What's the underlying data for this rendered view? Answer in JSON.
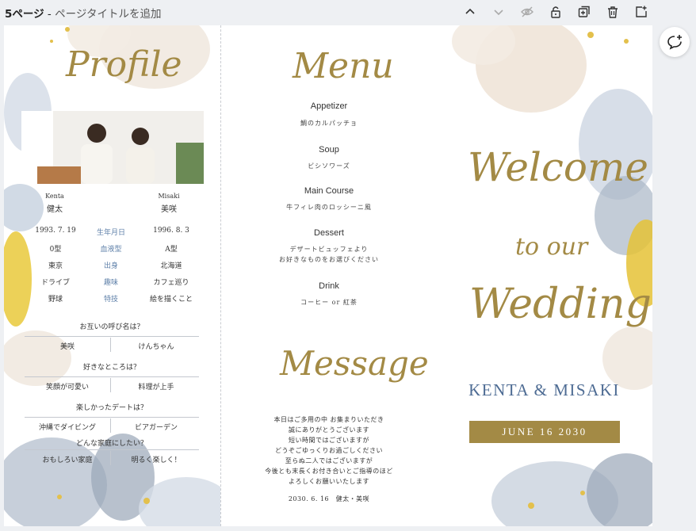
{
  "topbar": {
    "page_label": "5ページ",
    "separator": " - ",
    "title_placeholder": "ページタイトルを追加",
    "icons": [
      "chevron-up-icon",
      "chevron-down-icon",
      "eye-hidden-icon",
      "lock-icon",
      "duplicate-icon",
      "trash-icon",
      "add-page-icon"
    ]
  },
  "profile": {
    "heading": "Profile",
    "groom_en": "Kenta",
    "groom_jp": "健太",
    "bride_en": "Misaki",
    "bride_jp": "美咲",
    "rows": [
      {
        "groom": "1993. 7. 19",
        "label": "生年月日",
        "bride": "1996. 8. 3"
      },
      {
        "groom": "0型",
        "label": "血液型",
        "bride": "A型"
      },
      {
        "groom": "東京",
        "label": "出身",
        "bride": "北海道"
      },
      {
        "groom": "ドライブ",
        "label": "趣味",
        "bride": "カフェ巡り"
      },
      {
        "groom": "野球",
        "label": "特技",
        "bride": "絵を描くこと"
      }
    ],
    "qa": [
      {
        "q": "お互いの呼び名は？",
        "a1": "美咲",
        "a2": "けんちゃん"
      },
      {
        "q": "好きなところは？",
        "a1": "笑顔が可愛い",
        "a2": "料理が上手"
      },
      {
        "q": "楽しかったデートは？",
        "a1": "沖縄でダイビング",
        "a2": "ビアガーデン"
      },
      {
        "q": "どんな家庭にしたい？",
        "a1": "おもしろい家庭",
        "a2": "明るく楽しく！"
      }
    ]
  },
  "menu": {
    "heading": "Menu",
    "courses": [
      {
        "name": "Appetizer",
        "dish": "鯛のカルパッチョ"
      },
      {
        "name": "Soup",
        "dish": "ビシソワーズ"
      },
      {
        "name": "Main Course",
        "dish": "牛フィレ肉のロッシーニ風"
      },
      {
        "name": "Dessert",
        "dish": "デザートビュッフェより",
        "dish2": "お好きなものをお選びください"
      },
      {
        "name": "Drink",
        "dish": "コーヒー or 紅茶"
      }
    ]
  },
  "message": {
    "heading": "Message",
    "lines": [
      "本日はご多用の中 お集まりいただき",
      "誠にありがとうございます",
      "短い時間ではございますが",
      "どうぞごゆっくりお過ごしください",
      "至らぬ二人ではございますが",
      "今後とも末長くお付き合いとご指導のほど",
      "よろしくお願いいたします"
    ],
    "signature": "2030. 6. 16　健太・美咲"
  },
  "cover": {
    "welcome": "Welcome",
    "to_our": "to our",
    "wedding": "Wedding",
    "names": "KENTA & MISAKI",
    "date": "JUNE 16 2030"
  },
  "colors": {
    "gold": "#a38a45",
    "navy": "#4d6b93",
    "label_blue": "#5d7fa8",
    "date_band": "#a38a45"
  }
}
